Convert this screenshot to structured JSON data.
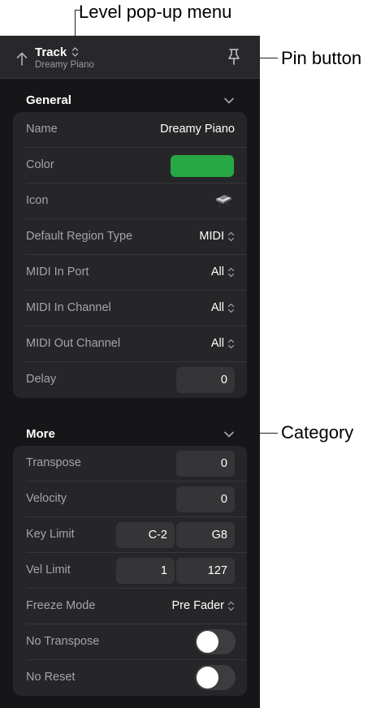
{
  "callouts": {
    "level_popup": "Level pop-up menu",
    "pin_button": "Pin button",
    "category": "Category"
  },
  "header": {
    "title": "Track",
    "subtitle": "Dreamy Piano"
  },
  "general": {
    "title": "General",
    "name_label": "Name",
    "name_value": "Dreamy Piano",
    "color_label": "Color",
    "color_value": "#28a745",
    "icon_label": "Icon",
    "icon_name": "piano-keyboard-icon",
    "region_type_label": "Default Region Type",
    "region_type_value": "MIDI",
    "midi_in_port_label": "MIDI In Port",
    "midi_in_port_value": "All",
    "midi_in_channel_label": "MIDI In Channel",
    "midi_in_channel_value": "All",
    "midi_out_channel_label": "MIDI Out Channel",
    "midi_out_channel_value": "All",
    "delay_label": "Delay",
    "delay_value": "0"
  },
  "more": {
    "title": "More",
    "transpose_label": "Transpose",
    "transpose_value": "0",
    "velocity_label": "Velocity",
    "velocity_value": "0",
    "key_limit_label": "Key Limit",
    "key_limit_low": "C-2",
    "key_limit_high": "G8",
    "vel_limit_label": "Vel Limit",
    "vel_limit_low": "1",
    "vel_limit_high": "127",
    "freeze_mode_label": "Freeze Mode",
    "freeze_mode_value": "Pre Fader",
    "no_transpose_label": "No Transpose",
    "no_transpose_on": false,
    "no_reset_label": "No Reset",
    "no_reset_on": false
  },
  "colors": {
    "panel_bg": "#161618",
    "header_bg": "#28282b",
    "group_bg": "#262628",
    "accent_green": "#28a745"
  }
}
